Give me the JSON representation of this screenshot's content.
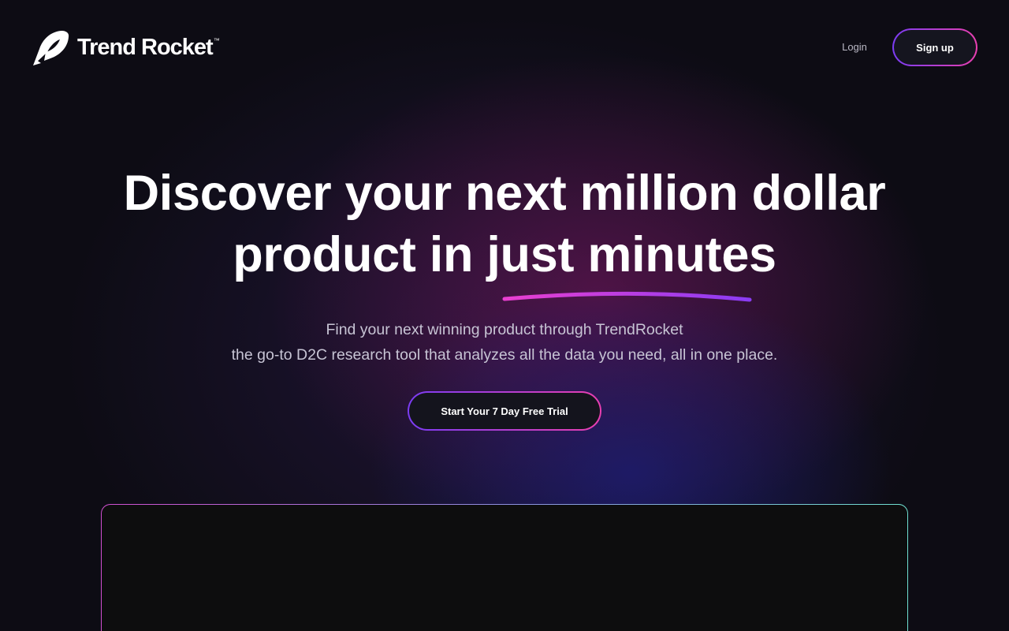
{
  "header": {
    "brand": {
      "name": "Trend Rocket",
      "trademark": "™",
      "icon": "rocket-logo-icon"
    },
    "login_label": "Login",
    "signup_label": "Sign up"
  },
  "hero": {
    "headline_line1": "Discover your next million dollar",
    "headline_line2": "product in just minutes",
    "subtext_line1": "Find your next winning product through TrendRocket",
    "subtext_line2": "the go-to D2C research tool that analyzes all the data you need, all in one place.",
    "cta_label": "Start Your 7 Day Free Trial"
  },
  "colors": {
    "background": "#0d0c14",
    "accent_purple": "#7b3cf3",
    "accent_pink": "#e93fb0",
    "button_fill": "#15151f",
    "preview_fill": "#0d0d0e"
  }
}
